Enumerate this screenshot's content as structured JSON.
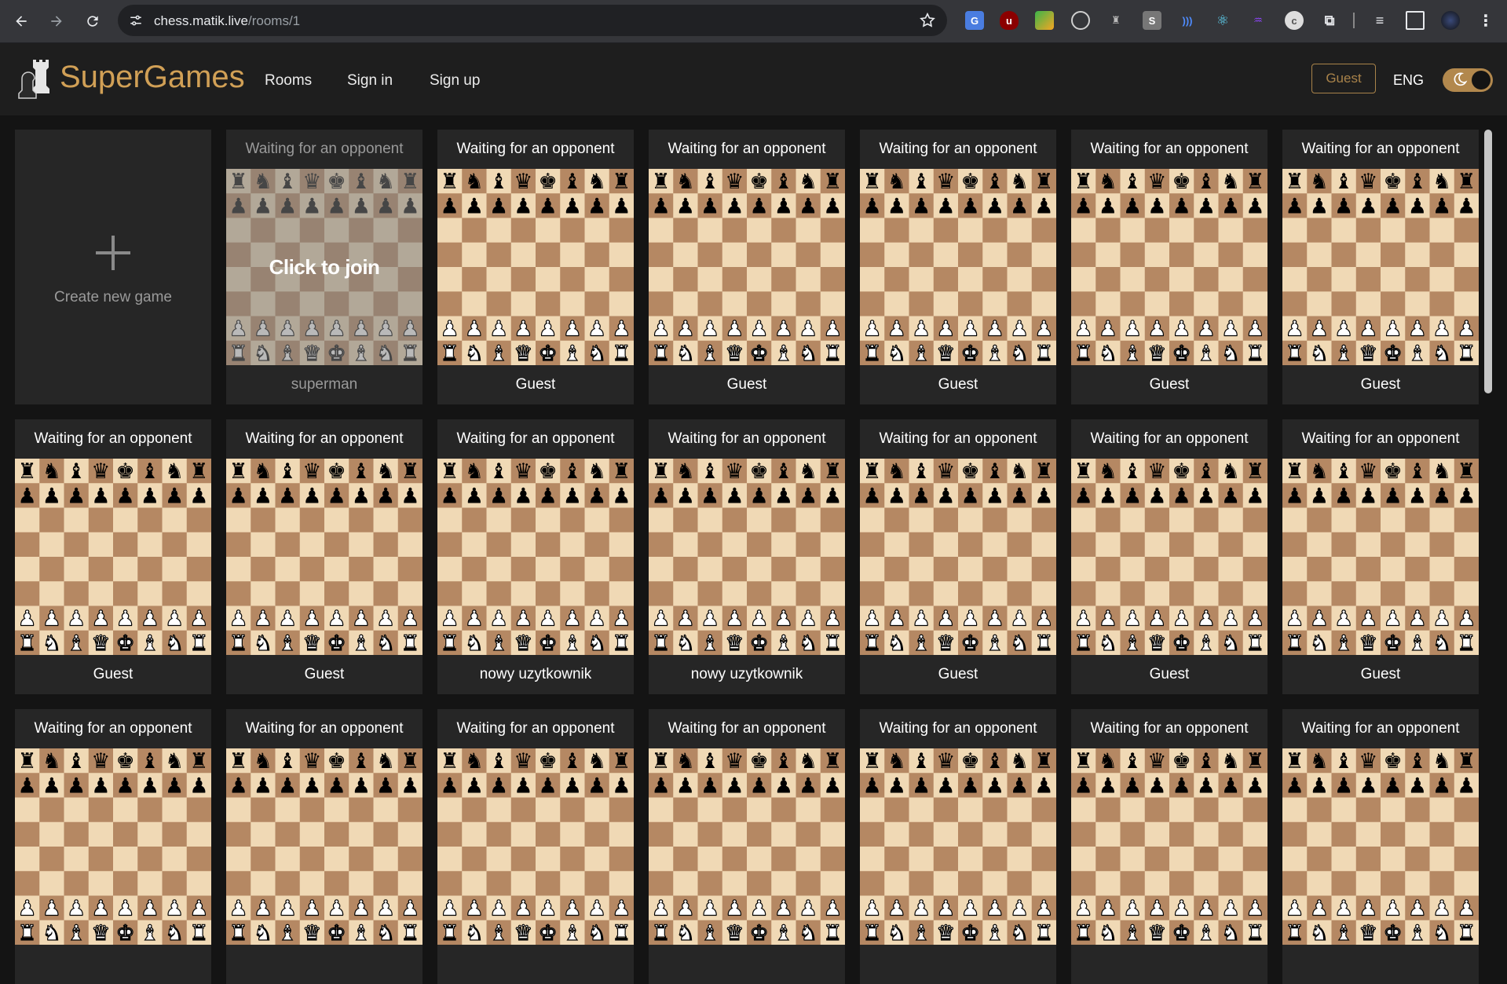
{
  "browser": {
    "url_host": "chess.matik.live",
    "url_path": "/rooms/1"
  },
  "header": {
    "brand": "SuperGames",
    "nav": [
      "Rooms",
      "Sign in",
      "Sign up"
    ],
    "user_button": "Guest",
    "language": "ENG",
    "theme": "dark"
  },
  "create_card": {
    "label": "Create new game"
  },
  "hover_label": "Click to join",
  "rooms": [
    {
      "status": "Waiting for an opponent",
      "player": "superman",
      "hovered": true
    },
    {
      "status": "Waiting for an opponent",
      "player": "Guest"
    },
    {
      "status": "Waiting for an opponent",
      "player": "Guest"
    },
    {
      "status": "Waiting for an opponent",
      "player": "Guest"
    },
    {
      "status": "Waiting for an opponent",
      "player": "Guest"
    },
    {
      "status": "Waiting for an opponent",
      "player": "Guest"
    },
    {
      "status": "Waiting for an opponent",
      "player": "Guest"
    },
    {
      "status": "Waiting for an opponent",
      "player": "Guest"
    },
    {
      "status": "Waiting for an opponent",
      "player": "nowy uzytkownik"
    },
    {
      "status": "Waiting for an opponent",
      "player": "nowy uzytkownik"
    },
    {
      "status": "Waiting for an opponent",
      "player": "Guest"
    },
    {
      "status": "Waiting for an opponent",
      "player": "Guest"
    },
    {
      "status": "Waiting for an opponent",
      "player": "Guest"
    },
    {
      "status": "Waiting for an opponent",
      "player": ""
    },
    {
      "status": "Waiting for an opponent",
      "player": ""
    },
    {
      "status": "Waiting for an opponent",
      "player": ""
    },
    {
      "status": "Waiting for an opponent",
      "player": ""
    },
    {
      "status": "Waiting for an opponent",
      "player": ""
    },
    {
      "status": "Waiting for an opponent",
      "player": ""
    },
    {
      "status": "Waiting for an opponent",
      "player": ""
    }
  ],
  "board": {
    "light_color": "#f0d9b5",
    "dark_color": "#b58863",
    "ranks": [
      "rnbqkbnr",
      "pppppppp",
      "",
      "",
      "",
      "",
      "PPPPPPPP",
      "RNBQKBNR"
    ]
  },
  "colors": {
    "accent": "#d1a056",
    "page_bg": "#141414",
    "card_bg": "#262626"
  }
}
